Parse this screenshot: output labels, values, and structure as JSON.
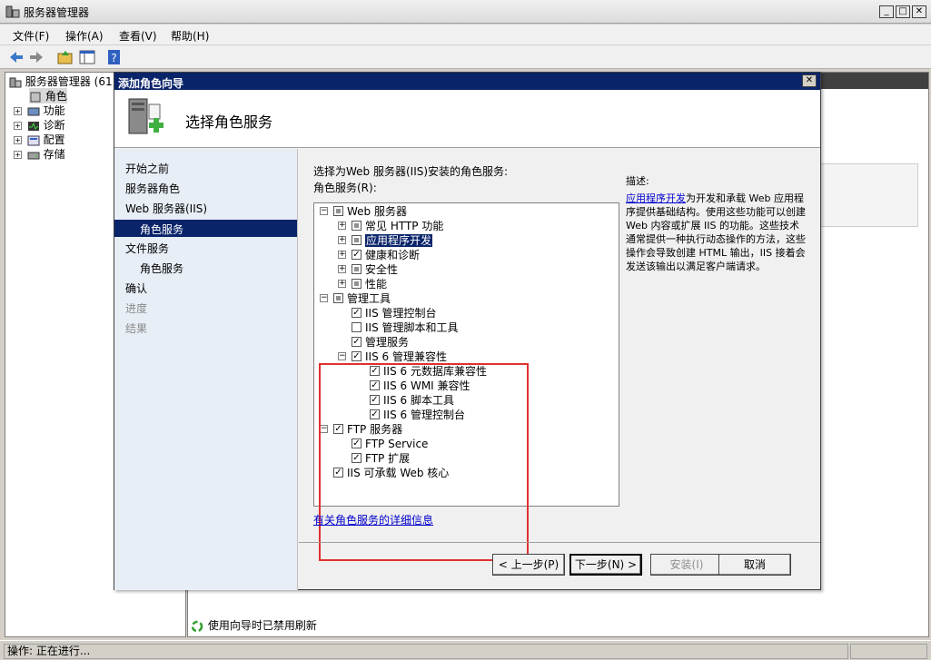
{
  "window": {
    "title": "服务器管理器"
  },
  "menu": [
    "文件(F)",
    "操作(A)",
    "查看(V)",
    "帮助(H)"
  ],
  "left_tree": {
    "root": "服务器管理器 (61",
    "items": [
      "角色",
      "功能",
      "诊断",
      "配置",
      "存储"
    ]
  },
  "right_pane": {
    "status_text": "使用向导时已禁用刷新"
  },
  "statusbar": {
    "text": "操作:  正在进行..."
  },
  "dialog": {
    "title": "添加角色向导",
    "header_title": "选择角色服务",
    "nav": [
      {
        "label": "开始之前",
        "state": "normal"
      },
      {
        "label": "服务器角色",
        "state": "normal"
      },
      {
        "label": "Web 服务器(IIS)",
        "state": "normal"
      },
      {
        "label": "角色服务",
        "state": "selected"
      },
      {
        "label": "文件服务",
        "state": "normal"
      },
      {
        "label": "角色服务",
        "state": "normal"
      },
      {
        "label": "确认",
        "state": "normal"
      },
      {
        "label": "进度",
        "state": "disabled"
      },
      {
        "label": "结果",
        "state": "disabled"
      }
    ],
    "instruction": "选择为Web 服务器(IIS)安装的角色服务:",
    "list_label": "角色服务(R):",
    "tree": [
      {
        "label": "Web 服务器",
        "level": 0,
        "check": "partial",
        "expander": "-"
      },
      {
        "label": "常见 HTTP 功能",
        "level": 1,
        "check": "partial",
        "expander": "+"
      },
      {
        "label": "应用程序开发",
        "level": 1,
        "check": "partial",
        "expander": "+",
        "selected": true
      },
      {
        "label": "健康和诊断",
        "level": 1,
        "check": "checked",
        "expander": "+"
      },
      {
        "label": "安全性",
        "level": 1,
        "check": "partial",
        "expander": "+"
      },
      {
        "label": "性能",
        "level": 1,
        "check": "partial",
        "expander": "+"
      },
      {
        "label": "管理工具",
        "level": 0,
        "check": "partial",
        "expander": "-"
      },
      {
        "label": "IIS 管理控制台",
        "level": 1,
        "check": "checked",
        "expander": ""
      },
      {
        "label": "IIS 管理脚本和工具",
        "level": 1,
        "check": "unchecked",
        "expander": ""
      },
      {
        "label": "管理服务",
        "level": 1,
        "check": "checked",
        "expander": ""
      },
      {
        "label": "IIS 6 管理兼容性",
        "level": 1,
        "check": "checked",
        "expander": "-"
      },
      {
        "label": "IIS 6 元数据库兼容性",
        "level": 2,
        "check": "checked",
        "expander": ""
      },
      {
        "label": "IIS 6 WMI 兼容性",
        "level": 2,
        "check": "checked",
        "expander": ""
      },
      {
        "label": "IIS 6 脚本工具",
        "level": 2,
        "check": "checked",
        "expander": ""
      },
      {
        "label": "IIS 6 管理控制台",
        "level": 2,
        "check": "checked",
        "expander": ""
      },
      {
        "label": "FTP 服务器",
        "level": 0,
        "check": "checked",
        "expander": "-"
      },
      {
        "label": "FTP Service",
        "level": 1,
        "check": "checked",
        "expander": ""
      },
      {
        "label": "FTP 扩展",
        "level": 1,
        "check": "checked",
        "expander": ""
      },
      {
        "label": "IIS 可承载 Web 核心",
        "level": 0,
        "check": "checked",
        "expander": ""
      }
    ],
    "description_label": "描述:",
    "description_link": "应用程序开发",
    "description_text": "为开发和承载 Web 应用程序提供基础结构。使用这些功能可以创建 Web 内容或扩展 IIS 的功能。这些技术通常提供一种执行动态操作的方法，这些操作会导致创建 HTML 输出，IIS 接着会发送该输出以满足客户端请求。",
    "more_info_link": "有关角色服务的详细信息",
    "buttons": {
      "prev": "< 上一步(P)",
      "next": "下一步(N) >",
      "install": "安装(I)",
      "cancel": "取消"
    }
  }
}
